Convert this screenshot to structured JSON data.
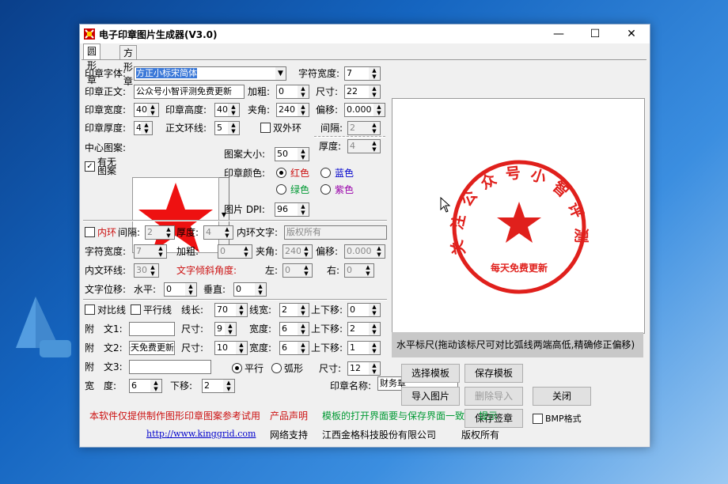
{
  "window": {
    "title": "电子印章图片生成器(V3.0)"
  },
  "tabs": [
    {
      "label": "圆形章"
    },
    {
      "label": "方形章"
    }
  ],
  "form": {
    "font_label": "印章字体:",
    "font_value": "方正小标宋简体",
    "char_width_label": "字符宽度:",
    "char_width_value": "7",
    "body_label": "印章正文:",
    "body_value": "公众号小智评测免费更新",
    "bold_label": "加粗:",
    "bold_value": "0",
    "size_label": "尺寸:",
    "size_value": "22",
    "seal_width_label": "印章宽度:",
    "seal_width_value": "40",
    "seal_height_label": "印章高度:",
    "seal_height_value": "40",
    "angle_label": "夹角:",
    "angle_value": "240",
    "offset_label": "偏移:",
    "offset_value": "0.000",
    "thickness_label": "印章厚度:",
    "thickness_value": "4",
    "ring_label": "正文环线:",
    "ring_value": "5",
    "double_ring_label": "双外环",
    "gap_label": "间隔:",
    "gap_value": "2",
    "thick2_label": "厚度:",
    "thick2_value": "4",
    "center_label": "中心图案:",
    "has_pattern_label": "有无图案",
    "pattern_size_label": "图案大小:",
    "pattern_size_value": "50",
    "color_label": "印章颜色:",
    "colors": {
      "red": "红色",
      "blue": "蓝色",
      "green": "绿色",
      "purple": "紫色"
    },
    "dpi_label": "图片 DPI:",
    "dpi_value": "96",
    "inner_ring_label": "内环",
    "inner_gap_label": "间隔:",
    "inner_gap_value": "2",
    "inner_thick_label": "厚度:",
    "inner_thick_value": "4",
    "inner_text_label": "内环文字:",
    "inner_text_value": "版权所有",
    "char_w2_label": "字符宽度:",
    "char_w2_value": "7",
    "bold2_label": "加粗:",
    "bold2_value": "0",
    "angle2_label": "夹角:",
    "angle2_value": "240",
    "offset2_label": "偏移:",
    "offset2_value": "0.000",
    "inner_ring2_label": "内文环线:",
    "inner_ring2_value": "30",
    "tilt_label": "文字倾斜角度:",
    "left_label": "左:",
    "left_value": "0",
    "right_label": "右:",
    "right_value": "0",
    "shift_label": "文字位移:",
    "horiz_label": "水平:",
    "horiz_value": "0",
    "vert_label": "垂直:",
    "vert_value": "0",
    "compare_line_label": "对比线",
    "parallel_line_label": "平行线",
    "line_len_label": "线长:",
    "line_len_value": "70",
    "line_width_label": "线宽:",
    "line_width_value": "2",
    "updown1_label": "上下移:",
    "updown1_value": "0",
    "text1_label": "附　文1:",
    "text1_value": "",
    "size1_label": "尺寸:",
    "size1_value": "9",
    "width1_label": "宽度:",
    "width1_value": "6",
    "updown2_label": "上下移:",
    "updown2_value": "2",
    "text2_label": "附　文2:",
    "text2_value": "每天免费更新",
    "size2_label": "尺寸:",
    "size2_value": "10",
    "width2_label": "宽度:",
    "width2_value": "6",
    "updown3_label": "上下移:",
    "updown3_value": "1",
    "text3_label": "附　文3:",
    "text3_value": "",
    "parallel_label": "平行",
    "arc_label": "弧形",
    "size3_label": "尺寸:",
    "size3_value": "12",
    "width_label": "宽　度:",
    "width_value": "6",
    "down_label": "下移:",
    "down_value": "2",
    "seal_name_label": "印章名称:",
    "seal_name_value": "财务章",
    "bmp_label": "BMP格式"
  },
  "preview": {
    "ring_text": "关注公众号小智评测免费更新",
    "bottom_text": "每天免费更新",
    "ruler_text": "水平标尺(拖动该标尺可对比弧线两端高低,精确修正偏移)",
    "seal_color": "#e0201c"
  },
  "buttons": {
    "select_template": "选择模板",
    "save_template": "保存模板",
    "import_image": "导入图片",
    "delete_import": "删除导入",
    "close": "关闭",
    "save_seal": "保存签章"
  },
  "footer": {
    "notice": "本软件仅提供制作图形印章图案参考试用",
    "statement": "产品声明",
    "tip_text": "模板的打开界面要与保存界面一致",
    "tip": "提示",
    "link": "http://www.kinggrid.com",
    "support": "网络支持",
    "company": "江西金格科技股份有限公司",
    "rights": "版权所有"
  }
}
